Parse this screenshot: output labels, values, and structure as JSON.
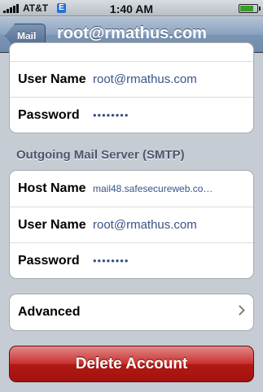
{
  "status_bar": {
    "carrier": "AT&T",
    "network_badge": "E",
    "time": "1:40 AM",
    "battery_level": 0.8
  },
  "nav": {
    "back_label": "Mail",
    "title": "root@rmathus.com"
  },
  "incoming_group": {
    "rows": [
      {
        "label": "User Name",
        "value": "root@rmathus.com"
      },
      {
        "label": "Password",
        "value": "••••••••"
      }
    ]
  },
  "outgoing_section": {
    "header": "Outgoing Mail Server (SMTP)",
    "rows": [
      {
        "label": "Host Name",
        "value": "mail48.safesecureweb.co…"
      },
      {
        "label": "User Name",
        "value": "root@rmathus.com"
      },
      {
        "label": "Password",
        "value": "••••••••"
      }
    ]
  },
  "advanced": {
    "label": "Advanced"
  },
  "delete_button": {
    "label": "Delete Account"
  },
  "colors": {
    "background": "#c5ccd4",
    "value_text": "#385487",
    "delete_red": "#b11a16"
  },
  "icons": [
    "signal-bars-icon",
    "battery-icon",
    "chevron-right-icon"
  ]
}
